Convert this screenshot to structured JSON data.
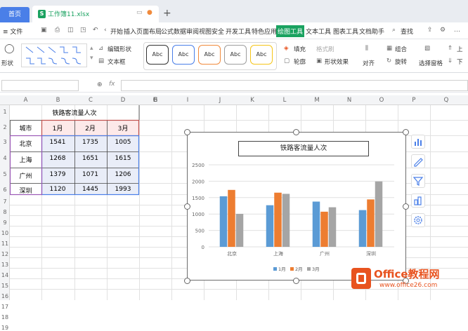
{
  "tabs": {
    "home": "首页",
    "file": "工作簿11.xlsx",
    "new_tab": "+"
  },
  "menu": {
    "file": "≡ 文件",
    "items": [
      "开始",
      "插入",
      "页面布局",
      "公式",
      "数据",
      "审阅",
      "视图",
      "安全",
      "开发工具",
      "特色应用",
      "绘图工具",
      "文本工具",
      "图表工具",
      "文档助手"
    ],
    "active": "绘图工具",
    "search": "查找"
  },
  "ribbon": {
    "shape_label": "形状",
    "edit_shape": "编辑形状",
    "text_box": "文本框",
    "style_label": "Abc",
    "fill": "填充",
    "format_brush": "格式刷",
    "outline": "轮廓",
    "shape_effect": "形状效果",
    "align": "对齐",
    "combine": "组合",
    "rotate": "旋转",
    "select_pane": "选择窗格",
    "up": "上",
    "down": "下",
    "abc_colors": [
      "#333333",
      "#4a7fe8",
      "#f08a3c",
      "#9e9e9e",
      "#f5c518"
    ]
  },
  "formula_bar": {
    "fx": "fx"
  },
  "sheet": {
    "columns": [
      "A",
      "B",
      "C",
      "D",
      "E",
      "F",
      "G",
      "H",
      "I",
      "J",
      "K",
      "L",
      "M",
      "N",
      "O",
      "P",
      "Q"
    ],
    "rows": [
      "1",
      "2",
      "3",
      "4",
      "5",
      "6",
      "7",
      "8",
      "9",
      "10",
      "11",
      "12",
      "13",
      "14",
      "15",
      "16",
      "17",
      "18",
      "19"
    ],
    "title": "铁路客流量人次",
    "header": [
      "城市",
      "1月",
      "2月",
      "3月"
    ],
    "data": [
      [
        "北京",
        "1541",
        "1735",
        "1005"
      ],
      [
        "上海",
        "1268",
        "1651",
        "1615"
      ],
      [
        "广州",
        "1379",
        "1071",
        "1206"
      ],
      [
        "深圳",
        "1120",
        "1445",
        "1993"
      ]
    ]
  },
  "chart_data": {
    "type": "bar",
    "title": "铁路客流量人次",
    "categories": [
      "北京",
      "上海",
      "广州",
      "深圳"
    ],
    "series": [
      {
        "name": "1月",
        "values": [
          1541,
          1268,
          1379,
          1120
        ],
        "color": "#5b9bd5"
      },
      {
        "name": "2月",
        "values": [
          1735,
          1651,
          1071,
          1445
        ],
        "color": "#ed7d31"
      },
      {
        "name": "3月",
        "values": [
          1005,
          1615,
          1206,
          1993
        ],
        "color": "#a5a5a5"
      }
    ],
    "yticks": [
      "0",
      "500",
      "1000",
      "1500",
      "2000",
      "2500"
    ],
    "ylim": [
      0,
      2500
    ],
    "legend": "bottom",
    "grid": true
  },
  "watermark": {
    "brand": "Office教程网",
    "url": "www.office26.com",
    "accent": "#e8531f"
  }
}
